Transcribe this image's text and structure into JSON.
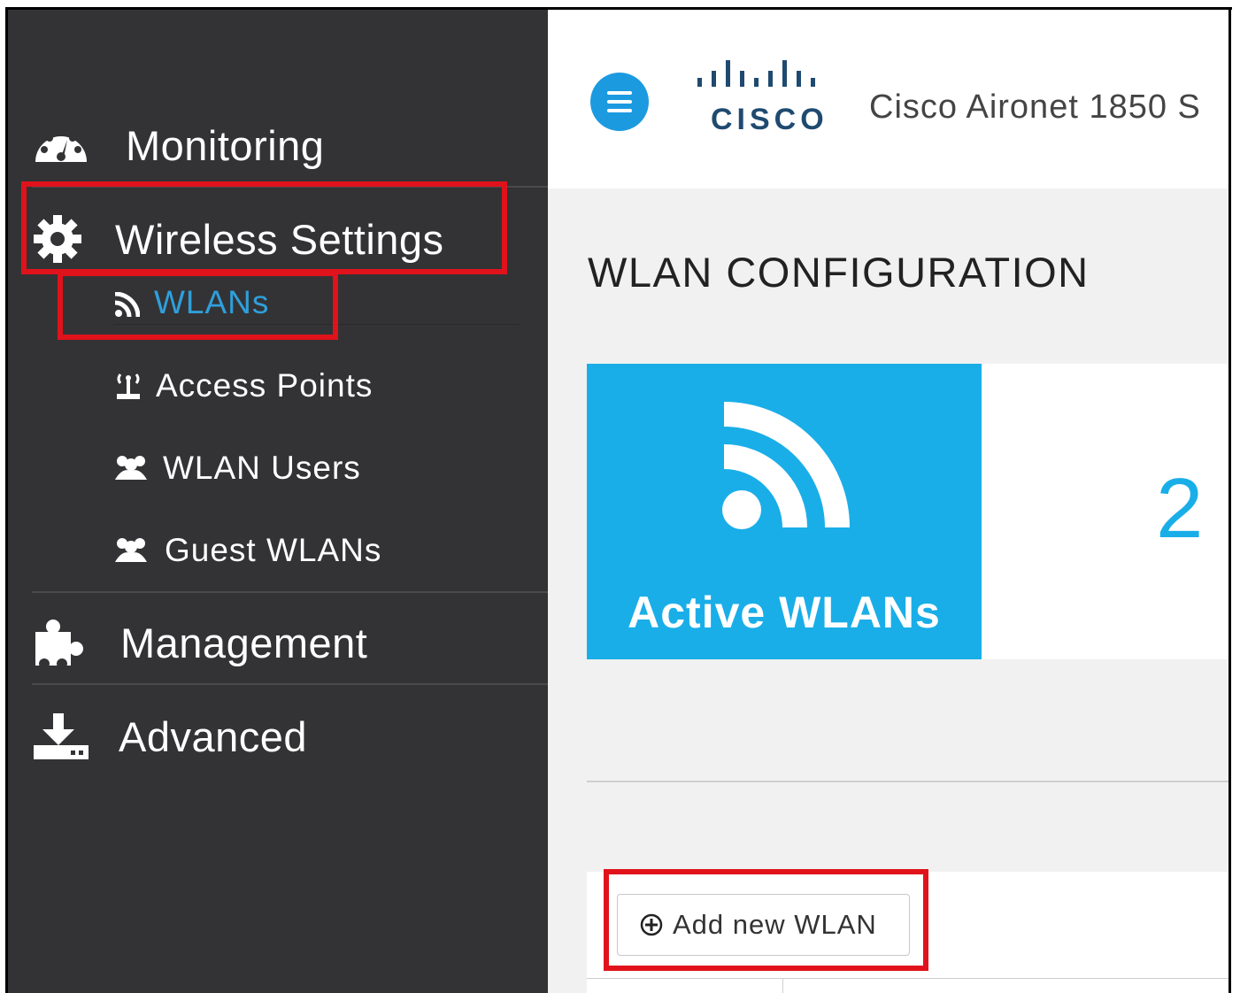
{
  "header": {
    "brand_word": "CISCO",
    "app_title": "Cisco Aironet 1850 S"
  },
  "sidebar": {
    "items": [
      {
        "label": "Monitoring",
        "icon": "dashboard-icon"
      },
      {
        "label": "Wireless Settings",
        "icon": "gear-icon"
      },
      {
        "label": "WLANs",
        "icon": "wifi-icon",
        "active": true
      },
      {
        "label": "Access Points",
        "icon": "access-point-icon"
      },
      {
        "label": "WLAN Users",
        "icon": "users-icon"
      },
      {
        "label": "Guest WLANs",
        "icon": "users-icon"
      },
      {
        "label": "Management",
        "icon": "puzzle-icon"
      },
      {
        "label": "Advanced",
        "icon": "download-icon"
      }
    ]
  },
  "main": {
    "page_title": "WLAN CONFIGURATION",
    "tile": {
      "label": "Active WLANs",
      "count": "2"
    },
    "add_button_label": "Add new WLAN"
  },
  "colors": {
    "sidebar_bg": "#333335",
    "accent_blue": "#1aaee8",
    "active_link": "#2f9fdc",
    "highlight_red": "#e0121b"
  }
}
